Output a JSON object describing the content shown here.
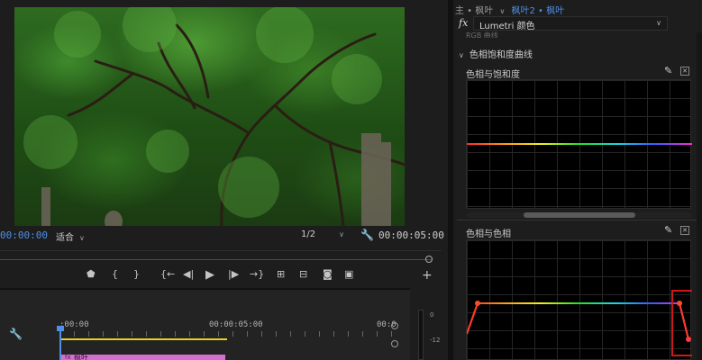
{
  "monitor": {
    "timecode_current": "00:00:00",
    "fit_label": "适合",
    "resolution_label": "1/2",
    "timecode_duration": "00:00:05:00"
  },
  "timeline": {
    "ruler_start": ":00:00",
    "ruler_mid": "00:00:05:00",
    "ruler_end": "00:0",
    "clip_label": "枫叶",
    "clip_fx": "fx"
  },
  "meter": {
    "top_label": "0",
    "mid_label": "-12"
  },
  "panel": {
    "breadcrumb_source": "主 • 枫叶",
    "breadcrumb_sep": "∨",
    "breadcrumb_active": "枫叶2 • 枫叶",
    "effect_prefix": "fx",
    "effect_name": "Lumetri 颜色",
    "rgb_curves_label": "RGB 曲线",
    "section_title": "色相饱和度曲线",
    "curve1_title": "色相与饱和度",
    "curve2_title": "色相与色相"
  },
  "icons": {
    "eyedropper": "eyedropper-icon",
    "wrench": "wrench-icon",
    "play": "play-icon"
  },
  "colors": {
    "accent": "#4f8fe6",
    "clip": "#d46fd0",
    "timeline_bar": "#e6d11c",
    "highlight_box": "#cc1a1a"
  }
}
